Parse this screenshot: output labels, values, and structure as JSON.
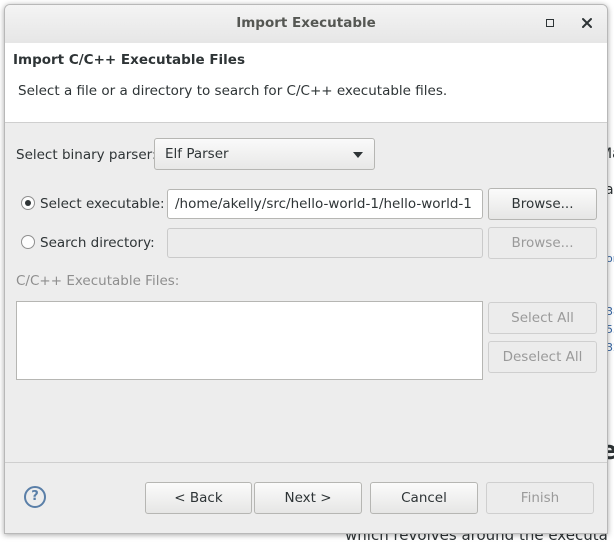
{
  "background": {
    "frag_ma": "Ma",
    "frag_al": "al",
    "link_1": "or",
    "link_2": "38",
    "link_3": "53",
    "link_4": "32",
    "frag_e": "e",
    "bottom_text": "which revolves around the executa"
  },
  "dialog": {
    "title": "Import Executable",
    "header": {
      "title": "Import C/C++ Executable Files",
      "description": "Select a file or a directory to search for C/C++ executable files."
    },
    "parser": {
      "label": "Select binary parser:",
      "value": "Elf Parser"
    },
    "select_executable": {
      "label": "Select executable:",
      "selected": true,
      "path": "/home/akelly/src/hello-world-1/hello-world-1",
      "browse_label": "Browse..."
    },
    "search_directory": {
      "label": "Search directory:",
      "selected": false,
      "path": "",
      "browse_label": "Browse..."
    },
    "files": {
      "label": "C/C++ Executable Files:",
      "items": [],
      "select_all_label": "Select All",
      "deselect_all_label": "Deselect All"
    },
    "footer": {
      "help_glyph": "?",
      "back_label": "< Back",
      "next_label": "Next >",
      "cancel_label": "Cancel",
      "finish_label": "Finish"
    }
  }
}
